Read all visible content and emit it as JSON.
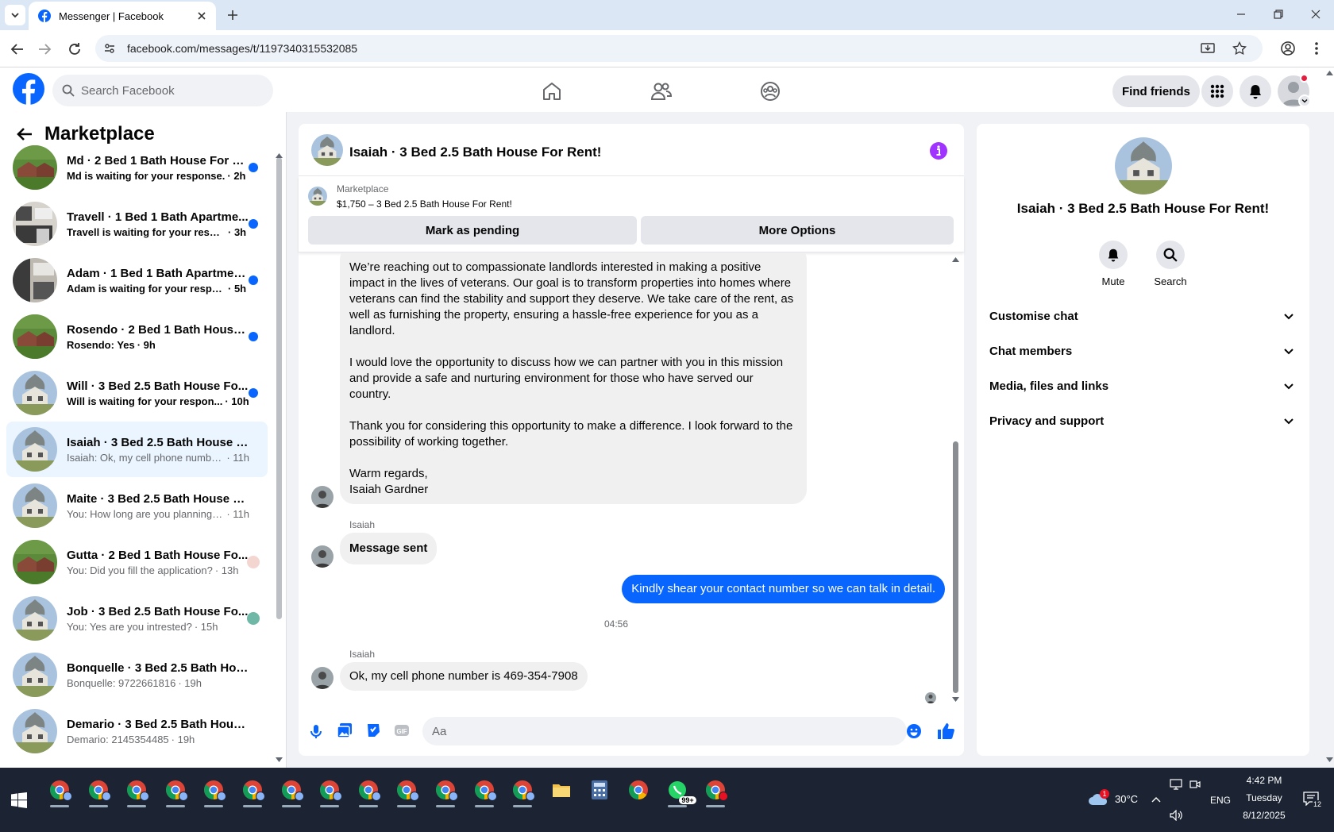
{
  "browser": {
    "tab_title": "Messenger | Facebook",
    "url": "facebook.com/messages/t/1197340315532085"
  },
  "fb_header": {
    "search_placeholder": "Search Facebook",
    "find_friends": "Find friends"
  },
  "sidebar": {
    "title": "Marketplace",
    "conversations": [
      {
        "name": "Md · 2 Bed 1 Bath House For R...",
        "preview": "Md is waiting for your response.",
        "time": "· 2h",
        "unread": true,
        "thumb": "house-brick"
      },
      {
        "name": "Travell · 1 Bed 1 Bath Apartme...",
        "preview": "Travell is waiting for your respo...",
        "time": "· 3h",
        "unread": true,
        "thumb": "kitchen"
      },
      {
        "name": "Adam · 1 Bed 1 Bath Apartmen...",
        "preview": "Adam is waiting for your respo...",
        "time": "· 5h",
        "unread": true,
        "thumb": "kitchen-dark"
      },
      {
        "name": "Rosendo · 2 Bed 1 Bath House ...",
        "preview": "Rosendo: Yes",
        "time": "· 9h",
        "unread": true,
        "thumb": "house-brick"
      },
      {
        "name": "Will · 3 Bed 2.5 Bath House Fo...",
        "preview": "Will is waiting for your respon...",
        "time": "· 10h",
        "unread": true,
        "thumb": "house-tree"
      },
      {
        "name": "Isaiah · 3 Bed 2.5 Bath House Fo...",
        "preview": "Isaiah: Ok, my cell phone number ...",
        "time": "· 11h",
        "unread": false,
        "active": true,
        "thumb": "house-tree"
      },
      {
        "name": "Maite · 3 Bed 2.5 Bath House Fo...",
        "preview": "You: How long are you planning t...",
        "time": "· 11h",
        "unread": false,
        "thumb": "house-tree"
      },
      {
        "name": "Gutta · 2 Bed 1 Bath House Fo...",
        "preview": "You: Did you fill the application?",
        "time": "· 13h",
        "unread": false,
        "thumb": "house-brick",
        "seen": "pink"
      },
      {
        "name": "Job · 3 Bed 2.5 Bath House Fo...",
        "preview": "You: Yes are you intrested?",
        "time": "· 15h",
        "unread": false,
        "thumb": "house-tree",
        "seen": "teal"
      },
      {
        "name": "Bonquelle · 3 Bed 2.5 Bath Hous...",
        "preview": "Bonquelle: 9722661816",
        "time": "· 19h",
        "unread": false,
        "thumb": "house-tree"
      },
      {
        "name": "Demario · 3 Bed 2.5 Bath House ...",
        "preview": "Demario: 2145354485",
        "time": "· 19h",
        "unread": false,
        "thumb": "house-tree"
      }
    ]
  },
  "chat": {
    "title": "Isaiah · 3 Bed 2.5 Bath House For Rent!",
    "listing_label": "Marketplace",
    "listing_price_title": "$1,750 – 3 Bed 2.5 Bath House For Rent!",
    "mark_pending": "Mark as pending",
    "more_options": "More Options",
    "long_message": [
      "We’re reaching out to compassionate landlords interested in making a positive impact in the lives of veterans. Our goal is to transform properties into homes where veterans can find the stability and support they deserve. We take care of the rent, as well as furnishing the property, ensuring a hassle-free experience for you as a landlord.",
      "I would love the opportunity to discuss how we can partner with you in this mission and provide a safe and nurturing environment for those who have served our country.",
      "Thank you for considering this opportunity to make a difference. I look forward to the possibility of working together.",
      "Warm regards,",
      "Isaiah Gardner"
    ],
    "sender_name_1": "Isaiah",
    "message_sent": "Message sent",
    "outgoing": "Kindly shear your contact number so we can talk in detail.",
    "timestamp": "04:56",
    "sender_name_2": "Isaiah",
    "last_incoming": "Ok, my cell phone number is 469-354-7908",
    "composer_placeholder": "Aa"
  },
  "details": {
    "title": "Isaiah · 3 Bed 2.5 Bath House For Rent!",
    "mute": "Mute",
    "search": "Search",
    "sections": [
      "Customise chat",
      "Chat members",
      "Media, files and links",
      "Privacy and support"
    ]
  },
  "taskbar": {
    "weather": "30°C",
    "weather_badge": "1",
    "lang": "ENG",
    "time": "4:42 PM",
    "day": "Tuesday",
    "date": "8/12/2025",
    "whatsapp_badge": "99+",
    "notif_count": "12"
  },
  "colors": {
    "fb_blue": "#0866ff",
    "unread_dot": "#0866ff",
    "info_purple": "#a033ff",
    "taskbar": "#1c2433"
  }
}
